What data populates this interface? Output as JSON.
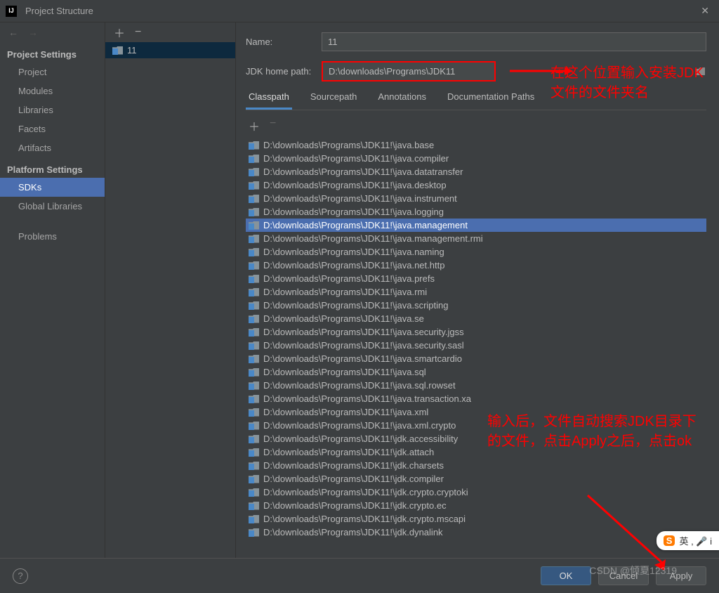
{
  "window": {
    "title": "Project Structure"
  },
  "sidebar": {
    "section_project": "Project Settings",
    "section_platform": "Platform Settings",
    "items_project": [
      {
        "label": "Project"
      },
      {
        "label": "Modules"
      },
      {
        "label": "Libraries"
      },
      {
        "label": "Facets"
      },
      {
        "label": "Artifacts"
      }
    ],
    "items_platform": [
      {
        "label": "SDKs",
        "selected": true
      },
      {
        "label": "Global Libraries"
      }
    ],
    "problems": "Problems"
  },
  "sdk_list": {
    "items": [
      {
        "label": "11",
        "selected": true
      }
    ]
  },
  "form": {
    "name_label": "Name:",
    "name_value": "11",
    "path_label": "JDK home path:",
    "path_value": "D:\\downloads\\Programs\\JDK11"
  },
  "tabs": [
    {
      "label": "Classpath",
      "active": true
    },
    {
      "label": "Sourcepath"
    },
    {
      "label": "Annotations"
    },
    {
      "label": "Documentation Paths"
    }
  ],
  "classpath_entries": [
    "D:\\downloads\\Programs\\JDK11!\\java.base",
    "D:\\downloads\\Programs\\JDK11!\\java.compiler",
    "D:\\downloads\\Programs\\JDK11!\\java.datatransfer",
    "D:\\downloads\\Programs\\JDK11!\\java.desktop",
    "D:\\downloads\\Programs\\JDK11!\\java.instrument",
    "D:\\downloads\\Programs\\JDK11!\\java.logging",
    "D:\\downloads\\Programs\\JDK11!\\java.management",
    "D:\\downloads\\Programs\\JDK11!\\java.management.rmi",
    "D:\\downloads\\Programs\\JDK11!\\java.naming",
    "D:\\downloads\\Programs\\JDK11!\\java.net.http",
    "D:\\downloads\\Programs\\JDK11!\\java.prefs",
    "D:\\downloads\\Programs\\JDK11!\\java.rmi",
    "D:\\downloads\\Programs\\JDK11!\\java.scripting",
    "D:\\downloads\\Programs\\JDK11!\\java.se",
    "D:\\downloads\\Programs\\JDK11!\\java.security.jgss",
    "D:\\downloads\\Programs\\JDK11!\\java.security.sasl",
    "D:\\downloads\\Programs\\JDK11!\\java.smartcardio",
    "D:\\downloads\\Programs\\JDK11!\\java.sql",
    "D:\\downloads\\Programs\\JDK11!\\java.sql.rowset",
    "D:\\downloads\\Programs\\JDK11!\\java.transaction.xa",
    "D:\\downloads\\Programs\\JDK11!\\java.xml",
    "D:\\downloads\\Programs\\JDK11!\\java.xml.crypto",
    "D:\\downloads\\Programs\\JDK11!\\jdk.accessibility",
    "D:\\downloads\\Programs\\JDK11!\\jdk.attach",
    "D:\\downloads\\Programs\\JDK11!\\jdk.charsets",
    "D:\\downloads\\Programs\\JDK11!\\jdk.compiler",
    "D:\\downloads\\Programs\\JDK11!\\jdk.crypto.cryptoki",
    "D:\\downloads\\Programs\\JDK11!\\jdk.crypto.ec",
    "D:\\downloads\\Programs\\JDK11!\\jdk.crypto.mscapi",
    "D:\\downloads\\Programs\\JDK11!\\jdk.dynalink"
  ],
  "selected_entry_index": 6,
  "buttons": {
    "ok": "OK",
    "cancel": "Cancel",
    "apply": "Apply"
  },
  "annotations": {
    "top": "在这个位置输入安装JDK文件的文件夹名",
    "bottom": "输入后，文件自动搜索JDK目录下的文件，点击Apply之后，点击ok"
  },
  "watermark": "CSDN @倾夏12319",
  "ime": {
    "brand": "S",
    "text": "英 , 🎤 i"
  }
}
